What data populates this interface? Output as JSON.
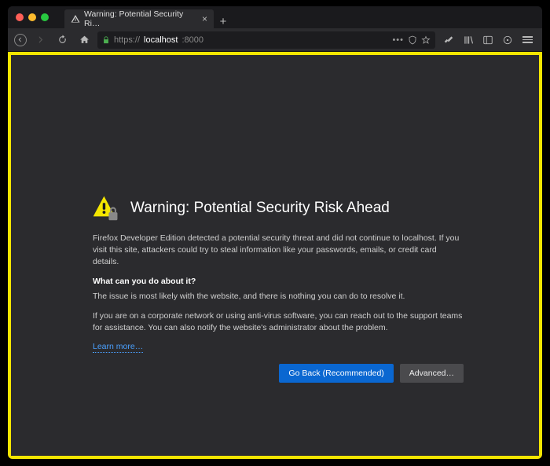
{
  "tab": {
    "label": "Warning: Potential Security Ri…"
  },
  "url": {
    "scheme": "https://",
    "host": "localhost",
    "path": ":8000"
  },
  "page": {
    "title": "Warning: Potential Security Risk Ahead",
    "intro": "Firefox Developer Edition detected a potential security threat and did not continue to localhost. If you visit this site, attackers could try to steal information like your passwords, emails, or credit card details.",
    "subhead": "What can you do about it?",
    "line1": "The issue is most likely with the website, and there is nothing you can do to resolve it.",
    "line2": "If you are on a corporate network or using anti-virus software, you can reach out to the support teams for assistance. You can also notify the website's administrator about the problem.",
    "learn_more": "Learn more…",
    "go_back": "Go Back (Recommended)",
    "advanced": "Advanced…"
  }
}
